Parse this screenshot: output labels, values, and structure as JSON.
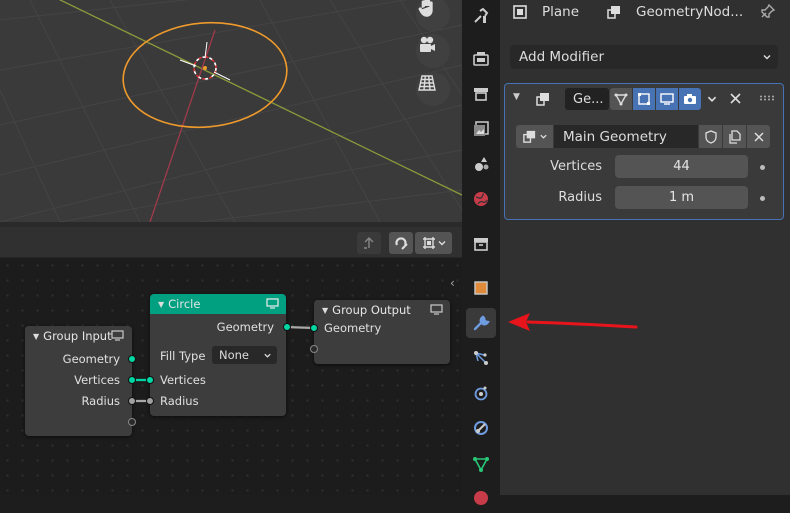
{
  "nodes": {
    "circle": {
      "title": "Circle",
      "output_geometry": "Geometry",
      "fill_type_label": "Fill Type",
      "fill_type_value": "None",
      "input_vertices": "Vertices",
      "input_radius": "Radius"
    },
    "group_input": {
      "title": "Group Input",
      "output_geometry": "Geometry",
      "output_vertices": "Vertices",
      "output_radius": "Radius"
    },
    "group_output": {
      "title": "Group Output",
      "input_geometry": "Geometry"
    }
  },
  "properties": {
    "object_name": "Plane",
    "nodegroup_name": "GeometryNod...",
    "add_modifier_label": "Add Modifier",
    "modifier": {
      "name_short": "Ge...",
      "node_group": "Main Geometry",
      "inputs": [
        {
          "label": "Vertices",
          "value": "44"
        },
        {
          "label": "Radius",
          "value": "1 m"
        }
      ]
    }
  },
  "colors": {
    "geometry_socket": "#00d6a3",
    "float_socket": "#a1a1a1",
    "circle_header": "#00a080",
    "io_header": "#3d3d3d",
    "arrow": "#e8141c",
    "panel_selected_border": "#4772b3"
  }
}
